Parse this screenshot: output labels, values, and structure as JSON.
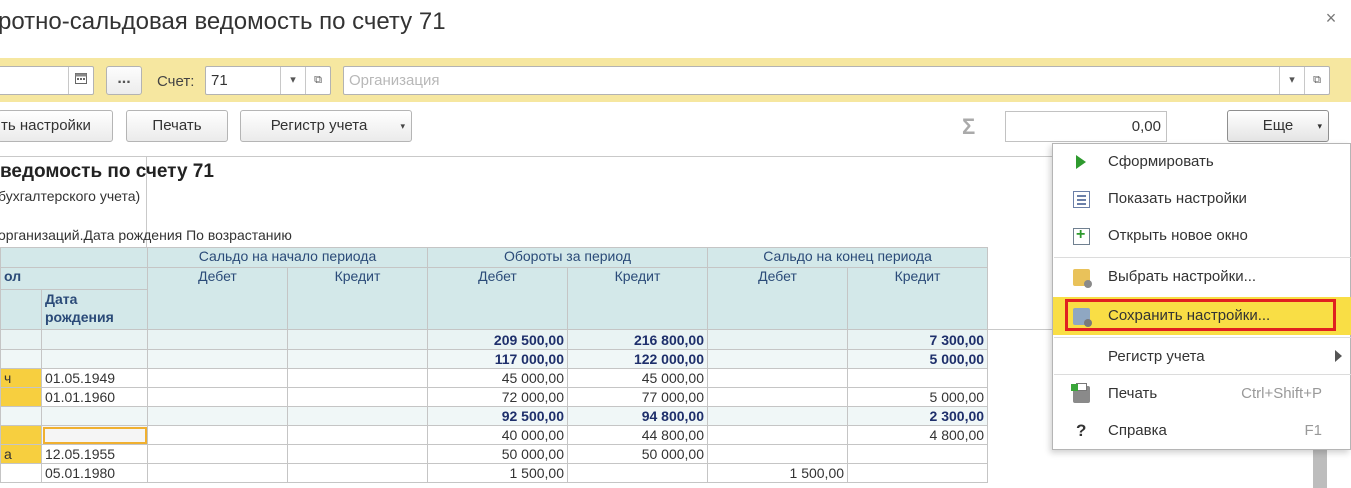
{
  "window": {
    "title": "ротно-сальдовая ведомость по счету 71",
    "close_glyph": "×"
  },
  "filter": {
    "calendar_icon": "calendar-icon",
    "dots_label": "...",
    "account_label": "Счет:",
    "account_value": "71",
    "org_placeholder": "Организация",
    "dropdown_glyph": "▾",
    "open_glyph": "⧉"
  },
  "toolbar": {
    "settings_label": "ть настройки",
    "print_label": "Печать",
    "register_label": "Регистр учета",
    "dropdown_glyph": "▾",
    "sigma": "Σ",
    "sum_value": "0,00",
    "more_label": "Еще"
  },
  "report": {
    "title": "ведомость по счету 71",
    "subtitle": "бухгалтерского учета)",
    "sort_line": "организаций.Дата рождения По возрастанию",
    "header": {
      "start_balance": "Сальдо на начало периода",
      "turnover": "Обороты за период",
      "end_balance": "Сальдо на конец периода",
      "debit": "Дебет",
      "credit": "Кредит",
      "col_a": "ол",
      "birth_date": "Дата рождения"
    },
    "rows": [
      {
        "kind": "tot",
        "a": "",
        "b": "",
        "sd": "",
        "sc": "",
        "td": "209 500,00",
        "tc": "216 800,00",
        "ed": "",
        "ec": "7 300,00"
      },
      {
        "kind": "grp",
        "a": "",
        "b": "",
        "sd": "",
        "sc": "",
        "td": "117 000,00",
        "tc": "122 000,00",
        "ed": "",
        "ec": "5 000,00"
      },
      {
        "kind": "row",
        "a": "ч",
        "b": "01.05.1949",
        "sd": "",
        "sc": "",
        "td": "45 000,00",
        "tc": "45 000,00",
        "ed": "",
        "ec": ""
      },
      {
        "kind": "row",
        "a": "",
        "b": "01.01.1960",
        "sd": "",
        "sc": "",
        "td": "72 000,00",
        "tc": "77 000,00",
        "ed": "",
        "ec": "5 000,00"
      },
      {
        "kind": "grp",
        "a": "",
        "b": "",
        "sd": "",
        "sc": "",
        "td": "92 500,00",
        "tc": "94 800,00",
        "ed": "",
        "ec": "2 300,00"
      },
      {
        "kind": "row",
        "a": "",
        "b": "",
        "sd": "",
        "sc": "",
        "td": "40 000,00",
        "tc": "44 800,00",
        "ed": "",
        "ec": "4 800,00"
      },
      {
        "kind": "row",
        "a": "а",
        "b": "12.05.1955",
        "sd": "",
        "sc": "",
        "td": "50 000,00",
        "tc": "50 000,00",
        "ed": "",
        "ec": ""
      },
      {
        "kind": "row",
        "a": "",
        "b": "05.01.1980",
        "sd": "",
        "sc": "",
        "td": "1 500,00",
        "tc": "",
        "ed": "1 500,00",
        "ec": ""
      }
    ]
  },
  "menu": {
    "items": [
      {
        "label": "Сформировать",
        "icon": "play-icon"
      },
      {
        "label": "Показать настройки",
        "icon": "settings-list-icon"
      },
      {
        "label": "Открыть новое окно",
        "icon": "new-window-icon"
      },
      {
        "label": "Выбрать настройки...",
        "icon": "folder-settings-icon"
      },
      {
        "label": "Сохранить настройки...",
        "icon": "save-settings-icon"
      },
      {
        "label": "Регистр учета",
        "icon": ""
      },
      {
        "label": "Печать",
        "icon": "print-icon",
        "shortcut": "Ctrl+Shift+P"
      },
      {
        "label": "Справка",
        "icon": "help-icon",
        "shortcut": "F1",
        "glyph": "?"
      }
    ]
  },
  "colors": {
    "filter_bar": "#f6e7a0",
    "header_bg": "#d3e8e9",
    "highlight": "#f9de45",
    "red_box": "#e02020",
    "group_text": "#1e2f6b"
  }
}
